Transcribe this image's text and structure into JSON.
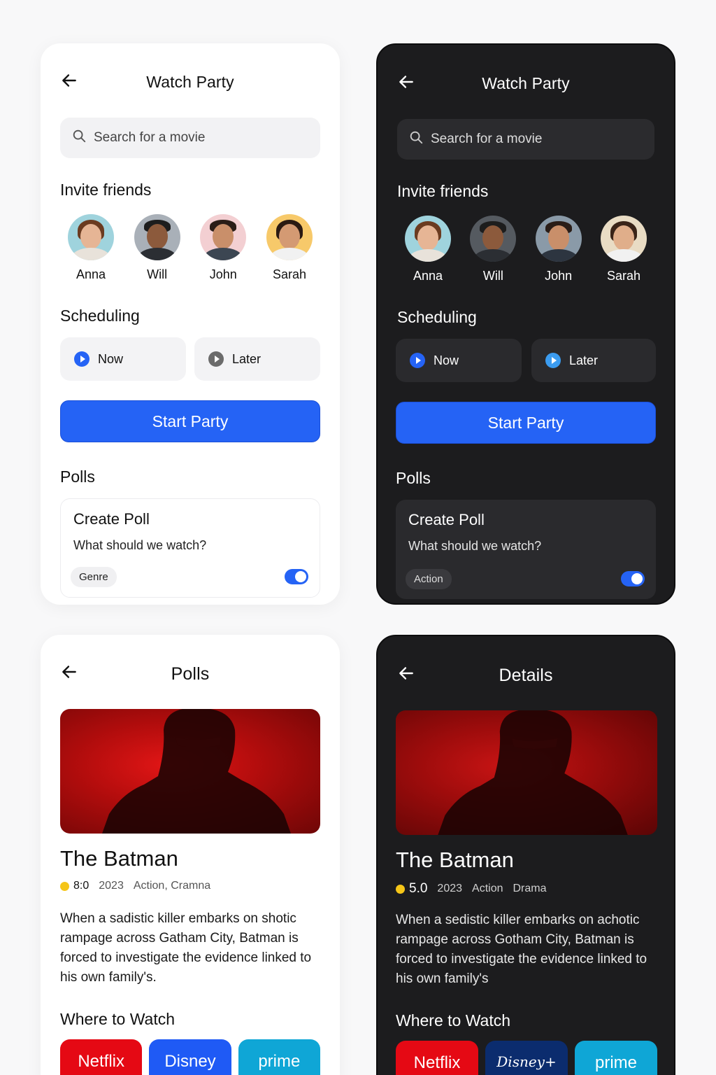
{
  "screens": {
    "watch_party_light": {
      "title": "Watch Party",
      "search_placeholder": "Search for a movie",
      "invite_heading": "Invite friends",
      "friends": [
        "Anna",
        "Will",
        "John",
        "Sarah"
      ],
      "scheduling_heading": "Scheduling",
      "schedule_now": "Now",
      "schedule_later": "Later",
      "start_button": "Start Party",
      "polls_heading": "Polls",
      "poll_title": "Create Poll",
      "poll_question": "What should we watch?",
      "poll_chip": "Genre"
    },
    "watch_party_dark": {
      "title": "Watch Party",
      "search_placeholder": "Search for a movie",
      "invite_heading": "Invite friends",
      "friends": [
        "Anna",
        "Will",
        "John",
        "Sarah"
      ],
      "scheduling_heading": "Scheduling",
      "schedule_now": "Now",
      "schedule_later": "Later",
      "start_button": "Start Party",
      "polls_heading": "Polls",
      "poll_title": "Create Poll",
      "poll_question": "What should we watch?",
      "poll_chip": "Action"
    },
    "polls_light": {
      "title": "Polls",
      "movie_title": "The Batman",
      "rating": "8:0",
      "year": "2023",
      "genres": "Action, Cramna",
      "description": "When a sadistic killer embarks on shotic rampage across Gatham City, Batman is forced to investigate the evidence linked to his own family's.",
      "where_heading": "Where to Watch",
      "providers": [
        "Netflix",
        "Disney",
        "prime"
      ]
    },
    "details_dark": {
      "title": "Details",
      "movie_title": "The Batman",
      "rating": "5.0",
      "year": "2023",
      "genre_1": "Action",
      "genre_2": "Drama",
      "description": "When a sedistic killer embarks on achotic rampage across Gotham City, Batman is forced to investigate the evidence linked to his own family's",
      "where_heading": "Where to Watch",
      "providers": [
        "Netflix",
        "Disney+",
        "prime"
      ]
    }
  },
  "colors": {
    "accent": "#2563f5",
    "dark_bg": "#1c1c1e",
    "netflix": "#e50914",
    "disney": "#1f5af5",
    "prime": "#0fa6d6",
    "hero_red": "#c80f0f",
    "rating_star": "#f5c518"
  },
  "icons": [
    "back-arrow-icon",
    "search-icon",
    "play-radio-icon",
    "star-icon",
    "toggle-switch"
  ]
}
